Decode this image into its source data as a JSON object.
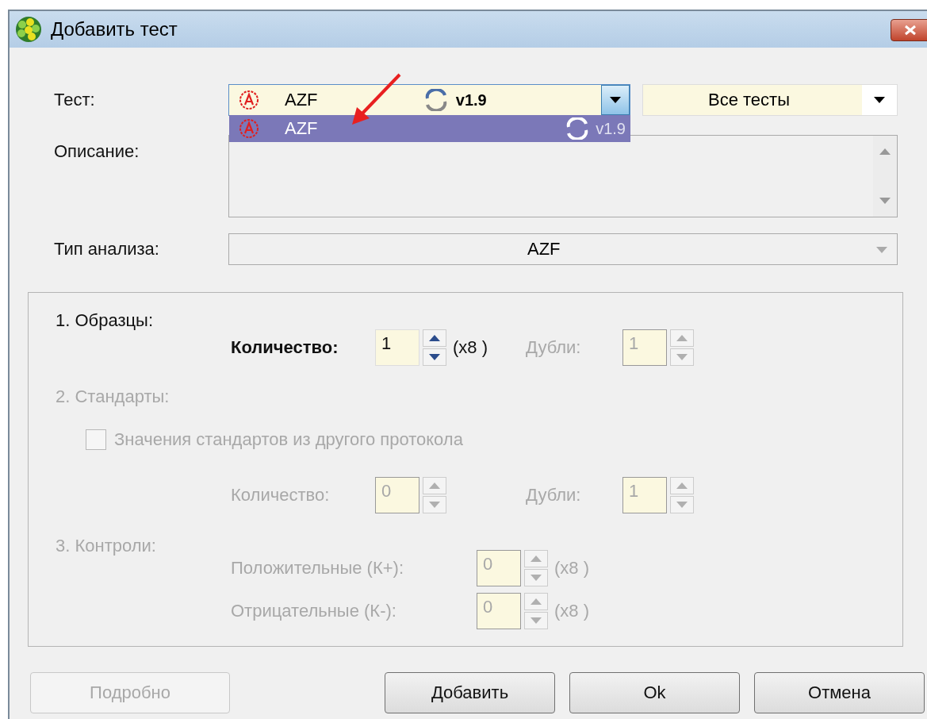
{
  "window": {
    "title": "Добавить тест"
  },
  "test": {
    "label": "Тест:",
    "value": "AZF",
    "version": "v1.9",
    "open": true
  },
  "test_options": [
    {
      "label": "AZF",
      "version": "v1.9",
      "selected": true
    }
  ],
  "filter": {
    "value": "Все тесты"
  },
  "description": {
    "label": "Описание:"
  },
  "analysis_type": {
    "label": "Тип анализа:",
    "value": "AZF"
  },
  "sections": [
    {
      "title": "1. Образцы:",
      "disabled": false,
      "kind": "pair",
      "rows": [
        [
          {
            "label": "Количество:",
            "value": "1",
            "suffix": "(x8 )",
            "disabled": false
          },
          {
            "label": "Дубли:",
            "value": "1",
            "disabled": true
          }
        ]
      ]
    },
    {
      "title": "2. Стандарты:",
      "disabled": true,
      "kind": "pair",
      "checkbox": {
        "label": "Значения стандартов из другого протокола",
        "checked": false,
        "disabled": true
      },
      "rows": [
        [
          {
            "label": "Количество:",
            "value": "0",
            "disabled": true
          },
          {
            "label": "Дубли:",
            "value": "1",
            "disabled": true
          }
        ]
      ]
    },
    {
      "title": "3. Контроли:",
      "disabled": true,
      "kind": "stack",
      "rows": [
        [
          {
            "label": "Положительные (К+):",
            "value": "0",
            "suffix": "(x8 )",
            "disabled": true
          }
        ],
        [
          {
            "label": "Отрицательные (К-):",
            "value": "0",
            "suffix": "(x8 )",
            "disabled": true
          }
        ]
      ]
    }
  ],
  "buttons": [
    {
      "label": "Подробно",
      "disabled": true
    },
    {
      "label": "Добавить",
      "disabled": false
    },
    {
      "label": "Ok",
      "disabled": false
    },
    {
      "label": "Отмена",
      "disabled": false
    }
  ]
}
